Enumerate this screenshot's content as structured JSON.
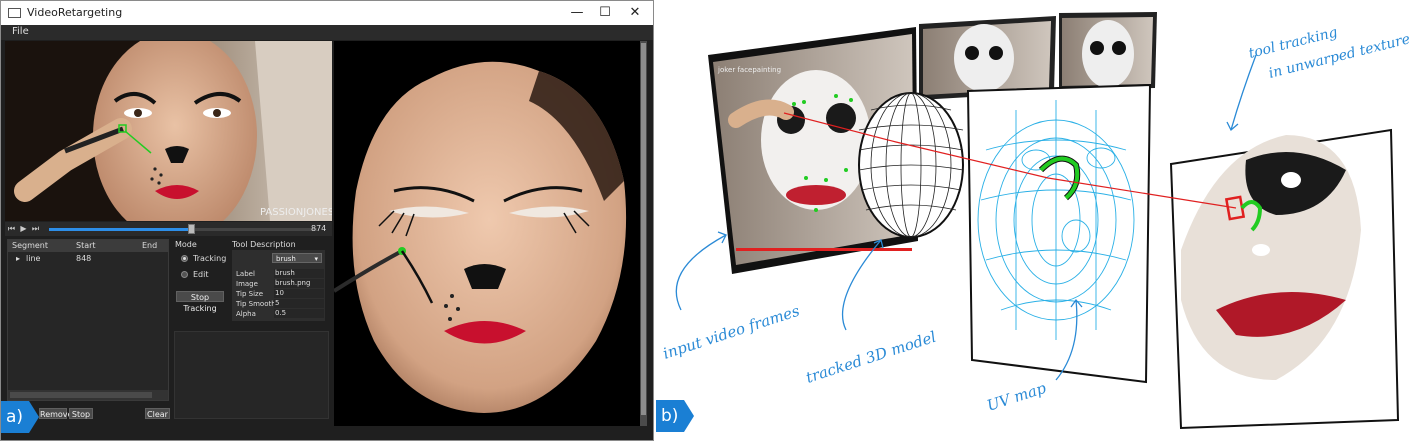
{
  "window": {
    "title": "VideoRetargeting",
    "controls": {
      "minimize": "—",
      "maximize": "☐",
      "close": "✕"
    },
    "menu": {
      "file": "File"
    }
  },
  "video": {
    "watermark": "PASSIONJONESZ",
    "frame_count": "874",
    "progress": 0.53
  },
  "segments": {
    "headers": [
      "Segment",
      "Start",
      "End"
    ],
    "rows": [
      {
        "name": "line",
        "start": "848",
        "end": ""
      }
    ],
    "buttons": {
      "remove": "Remove",
      "stop": "Stop",
      "clear": "Clear"
    }
  },
  "mode": {
    "title": "Mode",
    "options": [
      "Tracking",
      "Edit"
    ],
    "selected": "Tracking",
    "stop_tracking": "Stop Tracking"
  },
  "tool": {
    "title": "Tool Description",
    "selected": "brush",
    "props": [
      {
        "label": "Label",
        "value": "brush"
      },
      {
        "label": "Image",
        "value": "brush.png"
      },
      {
        "label": "Tip Size",
        "value": "10"
      },
      {
        "label": "Tip Smoothi",
        "value": "5"
      },
      {
        "label": "Alpha",
        "value": "0.5"
      }
    ]
  },
  "badges": {
    "a": "a)",
    "b": "b)"
  },
  "panel_b": {
    "youtube_title": "joker facepainting",
    "annotations": {
      "input": "input video frames",
      "model": "tracked 3D model",
      "uv": "UV map",
      "tool1": "tool tracking",
      "tool2": "in unwarped texture"
    }
  },
  "colors": {
    "accent": "#2d8ee8",
    "badge": "#1a7fd4",
    "annotation": "#2a8ad6",
    "track_green": "#22cc22",
    "track_red": "#e02020"
  }
}
